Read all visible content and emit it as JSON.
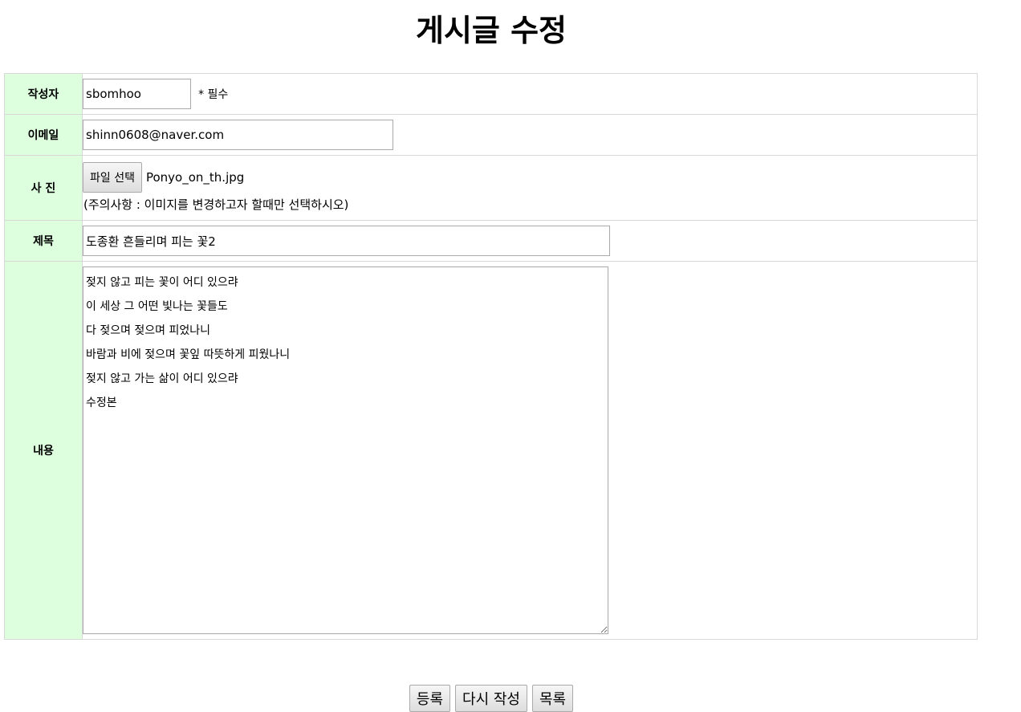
{
  "page": {
    "title": "게시글 수정"
  },
  "form": {
    "author": {
      "label": "작성자",
      "value": "sbomhoo",
      "required_note": "* 필수"
    },
    "email": {
      "label": "이메일",
      "value": "shinn0608@naver.com"
    },
    "photo": {
      "label": "사 진",
      "button_label": "파일 선택",
      "file_name": "Ponyo_on_th.jpg",
      "note": "(주의사항 : 이미지를 변경하고자 할때만 선택하시오)"
    },
    "subject": {
      "label": "제목",
      "value": "도종환 흔들리며 피는 꽃2"
    },
    "content": {
      "label": "내용",
      "value": "젖지 않고 피는 꽃이 어디 있으랴\n이 세상 그 어떤 빛나는 꽃들도\n다 젖으며 젖으며 피었나니\n바람과 비에 젖으며 꽃잎 따뜻하게 피웠나니\n젖지 않고 가는 삶이 어디 있으랴\n수정본"
    }
  },
  "buttons": {
    "submit": "등록",
    "reset": "다시 작성",
    "list": "목록"
  },
  "colors": {
    "label_background": "#ddffdd",
    "border": "#d8d8d8"
  }
}
